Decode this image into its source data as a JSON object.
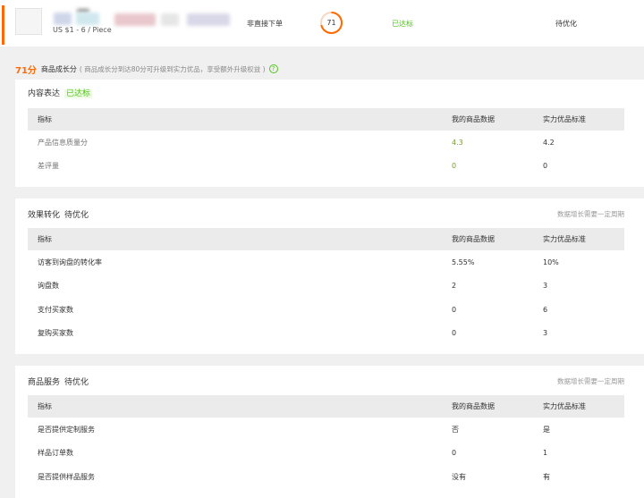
{
  "product": {
    "price": "US $1 - 6 / Piece",
    "order_type": "非直接下单",
    "score": "71",
    "status_met": "已达标",
    "status_optimize": "待优化"
  },
  "growth": {
    "score": "71分",
    "label": "商品成长分",
    "note": "( 商品成长分到达80分可升级到实力优品，享受额外升级权益 )",
    "help_icon": "?"
  },
  "sections": [
    {
      "title": "内容表达",
      "status": "已达标",
      "note": "",
      "headers": [
        "指标",
        "我的商品数据",
        "实力优品标准"
      ],
      "rows": [
        [
          "产品信息质量分",
          "4.3",
          "4.2"
        ],
        [
          "差评量",
          "0",
          "0"
        ]
      ]
    },
    {
      "title": "效果转化",
      "status": "待优化",
      "note": "数据增长需要一定周期",
      "headers": [
        "指标",
        "我的商品数据",
        "实力优品标准"
      ],
      "rows": [
        [
          "访客到询盘的转化率",
          "5.55%",
          "10%"
        ],
        [
          "询盘数",
          "2",
          "3"
        ],
        [
          "支付买家数",
          "0",
          "6"
        ],
        [
          "复购买家数",
          "0",
          "3"
        ]
      ]
    },
    {
      "title": "商品服务",
      "status": "待优化",
      "note": "数据增长需要一定周期",
      "headers": [
        "指标",
        "我的商品数据",
        "实力优品标准"
      ],
      "rows": [
        [
          "是否提供定制服务",
          "否",
          "是"
        ],
        [
          "样品订单数",
          "0",
          "1"
        ],
        [
          "是否提供样品服务",
          "没有",
          "有"
        ]
      ]
    }
  ],
  "colors": {
    "accent": "#ff6a00",
    "green": "#52c41a"
  }
}
